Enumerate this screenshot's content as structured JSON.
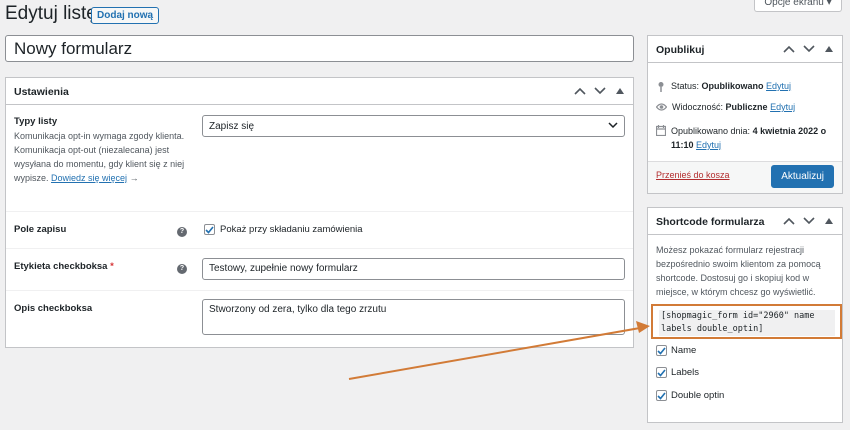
{
  "header": {
    "title": "Edytuj listę",
    "add_new_label": "Dodaj nową",
    "screen_options_label": "Opcje ekranu ▾"
  },
  "form_title": {
    "value": "Nowy formularz"
  },
  "settings": {
    "heading": "Ustawienia",
    "list_type": {
      "label": "Typy listy",
      "description": "Komunikacja opt-in wymaga zgody klienta. Komunikacja opt-out (niezalecana) jest wysyłana do momentu, gdy klient się z niej wypisze.",
      "link_text": "Dowiedz się więcej",
      "link_suffix": "→",
      "selected": "Zapisz się"
    },
    "save_field": {
      "label": "Pole zapisu",
      "checkbox_label": "Pokaż przy składaniu zamówienia",
      "checked": true
    },
    "checkbox_label_field": {
      "label": "Etykieta checkboksa",
      "required_mark": "*",
      "value": "Testowy, zupełnie nowy formularz"
    },
    "checkbox_description": {
      "label": "Opis checkboksa",
      "value": "Stworzony od zera, tylko dla tego zrzutu"
    }
  },
  "publish": {
    "heading": "Opublikuj",
    "status_label": "Status:",
    "status_value": "Opublikowano",
    "visibility_label": "Widoczność:",
    "visibility_value": "Publiczne",
    "published_label": "Opublikowano dnia:",
    "published_value": "4 kwietnia 2022 o 11:10",
    "edit_link": "Edytuj",
    "trash_label": "Przenieś do kosza",
    "update_label": "Aktualizuj"
  },
  "shortcode": {
    "heading": "Shortcode formularza",
    "description": "Możesz pokazać formularz rejestracji bezpośrednio swoim klientom za pomocą shortcode. Dostosuj go i skopiuj kod w miejsce, w którym chcesz go wyświetlić.",
    "code": "[shopmagic_form id=\"2960\" name labels double_optin]",
    "options": [
      {
        "label": "Name",
        "checked": true
      },
      {
        "label": "Labels",
        "checked": true
      },
      {
        "label": "Double optin",
        "checked": true
      }
    ]
  },
  "colors": {
    "accent": "#2271b1",
    "annotation": "#d27b37",
    "danger": "#b32d2e"
  }
}
